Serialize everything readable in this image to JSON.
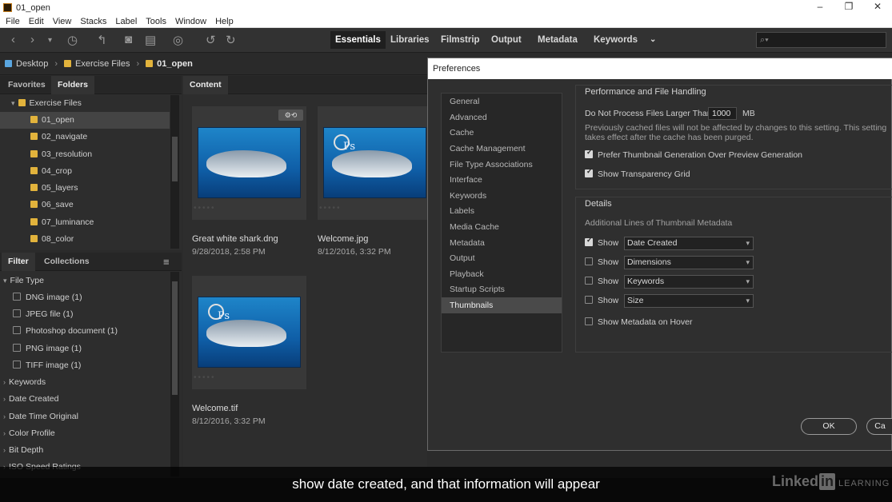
{
  "window": {
    "title": "01_open"
  },
  "menu": [
    "File",
    "Edit",
    "View",
    "Stacks",
    "Label",
    "Tools",
    "Window",
    "Help"
  ],
  "workspaces": [
    {
      "label": "Essentials",
      "active": true
    },
    {
      "label": "Libraries",
      "active": false
    },
    {
      "label": "Filmstrip",
      "active": false
    },
    {
      "label": "Output",
      "active": false
    },
    {
      "label": "Metadata",
      "active": false
    },
    {
      "label": "Keywords",
      "active": false
    }
  ],
  "search": {
    "placeholder": ""
  },
  "path": [
    "Desktop",
    "Exercise Files",
    "01_open"
  ],
  "left_tabs": {
    "favorites": "Favorites",
    "folders": "Folders"
  },
  "folders": {
    "root": "Exercise Files",
    "items": [
      "01_open",
      "02_navigate",
      "03_resolution",
      "04_crop",
      "05_layers",
      "06_save",
      "07_luminance",
      "08_color"
    ],
    "selected": "01_open"
  },
  "filter_tabs": {
    "filter": "Filter",
    "collections": "Collections"
  },
  "filter": {
    "file_type_label": "File Type",
    "file_types": [
      "DNG image (1)",
      "JPEG file (1)",
      "Photoshop document (1)",
      "PNG image (1)",
      "TIFF image (1)"
    ],
    "groups": [
      "Keywords",
      "Date Created",
      "Date Time Original",
      "Color Profile",
      "Bit Depth",
      "ISO Speed Ratings"
    ]
  },
  "content": {
    "tab": "Content",
    "items": [
      {
        "name": "Great white shark.dng",
        "date": "9/28/2018, 2:58 PM"
      },
      {
        "name": "Welcome.jpg",
        "date": "8/12/2016, 3:32 PM"
      },
      {
        "name": "Welcome.tif",
        "date": "8/12/2016, 3:32 PM"
      }
    ]
  },
  "preferences": {
    "title": "Preferences",
    "categories": [
      "General",
      "Advanced",
      "Cache",
      "Cache Management",
      "File Type Associations",
      "Interface",
      "Keywords",
      "Labels",
      "Media Cache",
      "Metadata",
      "Output",
      "Playback",
      "Startup Scripts",
      "Thumbnails"
    ],
    "selected_category": "Thumbnails",
    "perf": {
      "title": "Performance and File Handling",
      "dont_process_label": "Do Not Process Files Larger Than",
      "dont_process_value": "1000",
      "unit": "MB",
      "note_line1": "Previously cached files will not be affected by changes to this setting. This setting",
      "note_line2": "takes effect after the cache has been purged.",
      "prefer_thumb": "Prefer Thumbnail Generation Over Preview Generation",
      "show_transparency": "Show Transparency Grid"
    },
    "details": {
      "title": "Details",
      "additional_label": "Additional Lines of Thumbnail Metadata",
      "show_label": "Show",
      "rows": [
        {
          "checked": true,
          "value": "Date Created"
        },
        {
          "checked": false,
          "value": "Dimensions"
        },
        {
          "checked": false,
          "value": "Keywords"
        },
        {
          "checked": false,
          "value": "Size"
        }
      ],
      "hover_label": "Show Metadata on Hover"
    },
    "ok_label": "OK",
    "cancel_label": "Ca"
  },
  "caption": "show date created, and that information will appear",
  "brand": {
    "linked": "Linked",
    "in": "in",
    "learning": "LEARNING"
  }
}
